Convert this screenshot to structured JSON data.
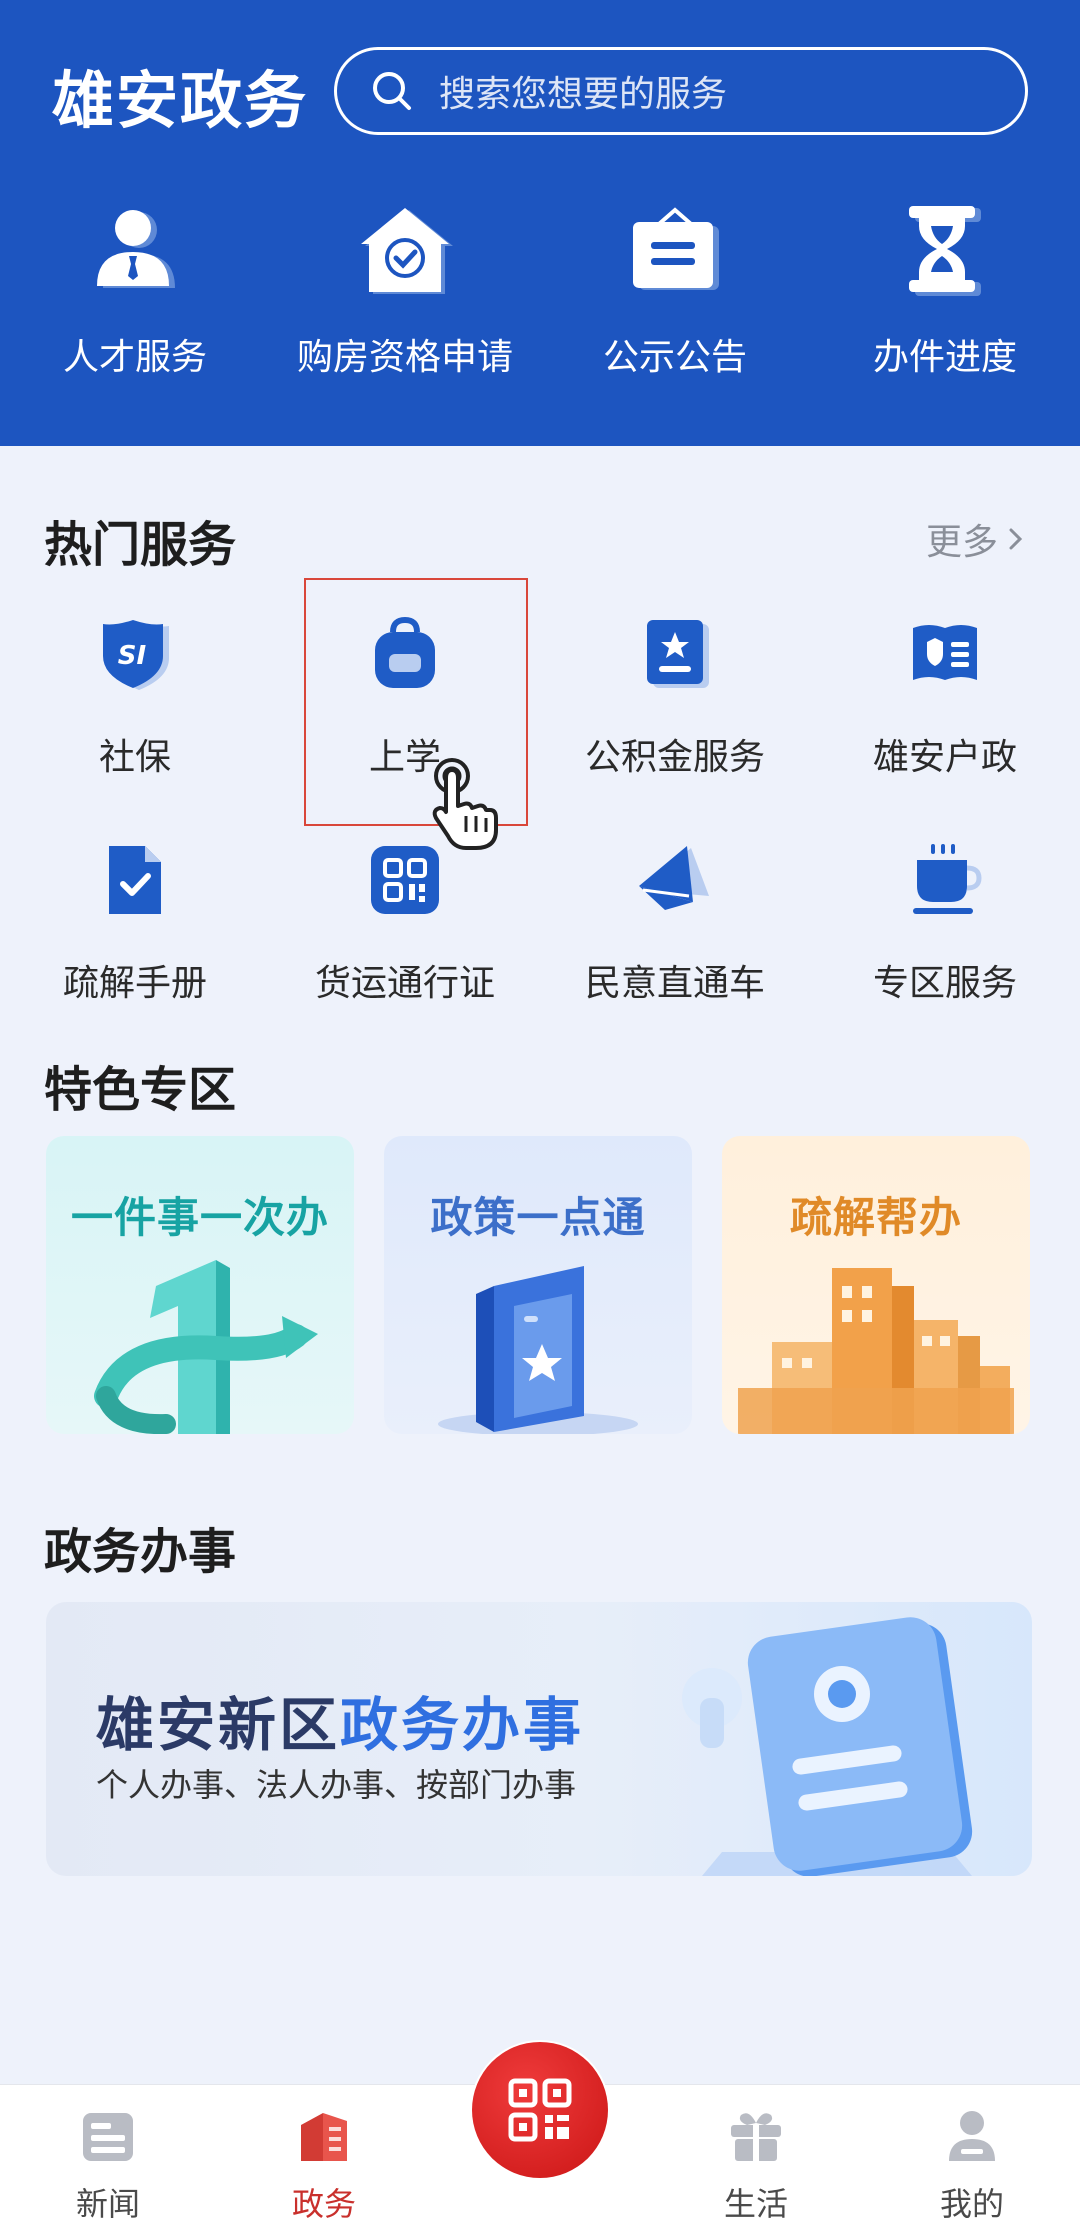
{
  "header": {
    "app_title": "雄安政务",
    "search_placeholder": "搜索您想要的服务",
    "quick_entries": [
      {
        "label": "人才服务",
        "icon": "person-badge-icon"
      },
      {
        "label": "购房资格申请",
        "icon": "house-check-icon"
      },
      {
        "label": "公示公告",
        "icon": "notice-board-icon"
      },
      {
        "label": "办件进度",
        "icon": "hourglass-icon"
      }
    ]
  },
  "hot_services": {
    "title": "热门服务",
    "more_label": "更多",
    "items": [
      {
        "label": "社保",
        "icon": "social-security-shield-icon"
      },
      {
        "label": "上学",
        "icon": "schoolbag-icon"
      },
      {
        "label": "公积金服务",
        "icon": "fund-book-icon"
      },
      {
        "label": "雄安户政",
        "icon": "household-card-icon"
      },
      {
        "label": "疏解手册",
        "icon": "document-check-icon"
      },
      {
        "label": "货运通行证",
        "icon": "qr-code-icon"
      },
      {
        "label": "民意直通车",
        "icon": "paper-plane-icon"
      },
      {
        "label": "专区服务",
        "icon": "cup-icon"
      }
    ]
  },
  "featured": {
    "title": "特色专区",
    "cards": [
      {
        "title": "一件事一次办"
      },
      {
        "title": "政策一点通"
      },
      {
        "title": "疏解帮办"
      }
    ]
  },
  "affairs": {
    "title": "政务办事",
    "banner_title_part1": "雄安新区",
    "banner_title_part2": "政务办事",
    "banner_subtitle": "个人办事、法人办事、按部门办事"
  },
  "tabbar": {
    "tabs": [
      {
        "label": "新闻",
        "icon": "news-icon"
      },
      {
        "label": "政务",
        "icon": "government-icon"
      },
      {
        "label": "生活",
        "icon": "gift-box-icon"
      },
      {
        "label": "我的",
        "icon": "user-icon"
      }
    ],
    "center_icon": "qr-scan-icon",
    "active_color": "#c9302c"
  },
  "colors": {
    "header_blue": "#1d55c0",
    "icon_blue": "#1f5cc6",
    "highlight_red": "#d9473a"
  }
}
